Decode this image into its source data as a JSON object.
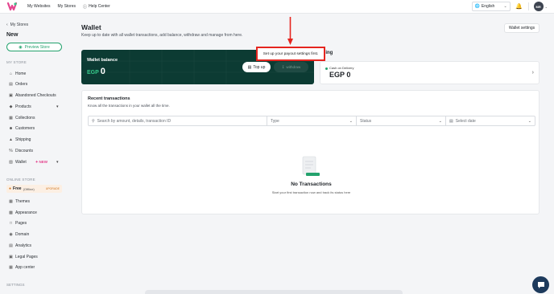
{
  "topbar": {
    "links": [
      "My Websites",
      "My Stores",
      "Help Center"
    ],
    "language": "English",
    "avatar_initials": "MR"
  },
  "sidebar": {
    "back_label": "My Stores",
    "store_name": "New",
    "preview_label": "Preview Store",
    "my_store_section": "MY STORE",
    "my_store_items": [
      "Home",
      "Orders",
      "Abandoned Checkouts",
      "Products",
      "Collections",
      "Customers",
      "Shipping",
      "Discounts",
      "Wallet"
    ],
    "wallet_badge": "NEW",
    "online_store_section": "ONLINE STORE",
    "free_label": "Free",
    "free_offline": "(Offline)",
    "free_upgrade": "UPGRADE",
    "online_store_items": [
      "Themes",
      "Appearance",
      "Pages",
      "Domain",
      "Analytics",
      "Legal Pages",
      "App center"
    ],
    "settings_section": "SETTINGS"
  },
  "main": {
    "title": "Wallet",
    "subtitle": "Keep up to date with all wallet transactions, add balance, withdraw and manage from here.",
    "settings_button": "Wallet settings",
    "balance": {
      "label": "Wallet balance",
      "currency": "EGP",
      "value": "0",
      "topup_label": "Top up",
      "withdraw_label": "withdraw"
    },
    "tooltip": "Set up your payout settings first.",
    "pending_title": "nding",
    "cod": {
      "label": "Cash on Delivery",
      "amount": "EGP 0"
    },
    "transactions": {
      "title": "Recent transactions",
      "subtitle": "Know all the transactions in your wallet all the time.",
      "search_placeholder": "Search by amount, details, transaction ID",
      "type_placeholder": "Type",
      "status_placeholder": "Status",
      "date_placeholder": "Select date",
      "empty_title": "No Transactions",
      "empty_sub": "Start your first transaction now and track its status here"
    }
  },
  "colors": {
    "brand_green": "#23a26d",
    "balance_card": "#0c3b33",
    "highlight_red": "#e5251f"
  }
}
